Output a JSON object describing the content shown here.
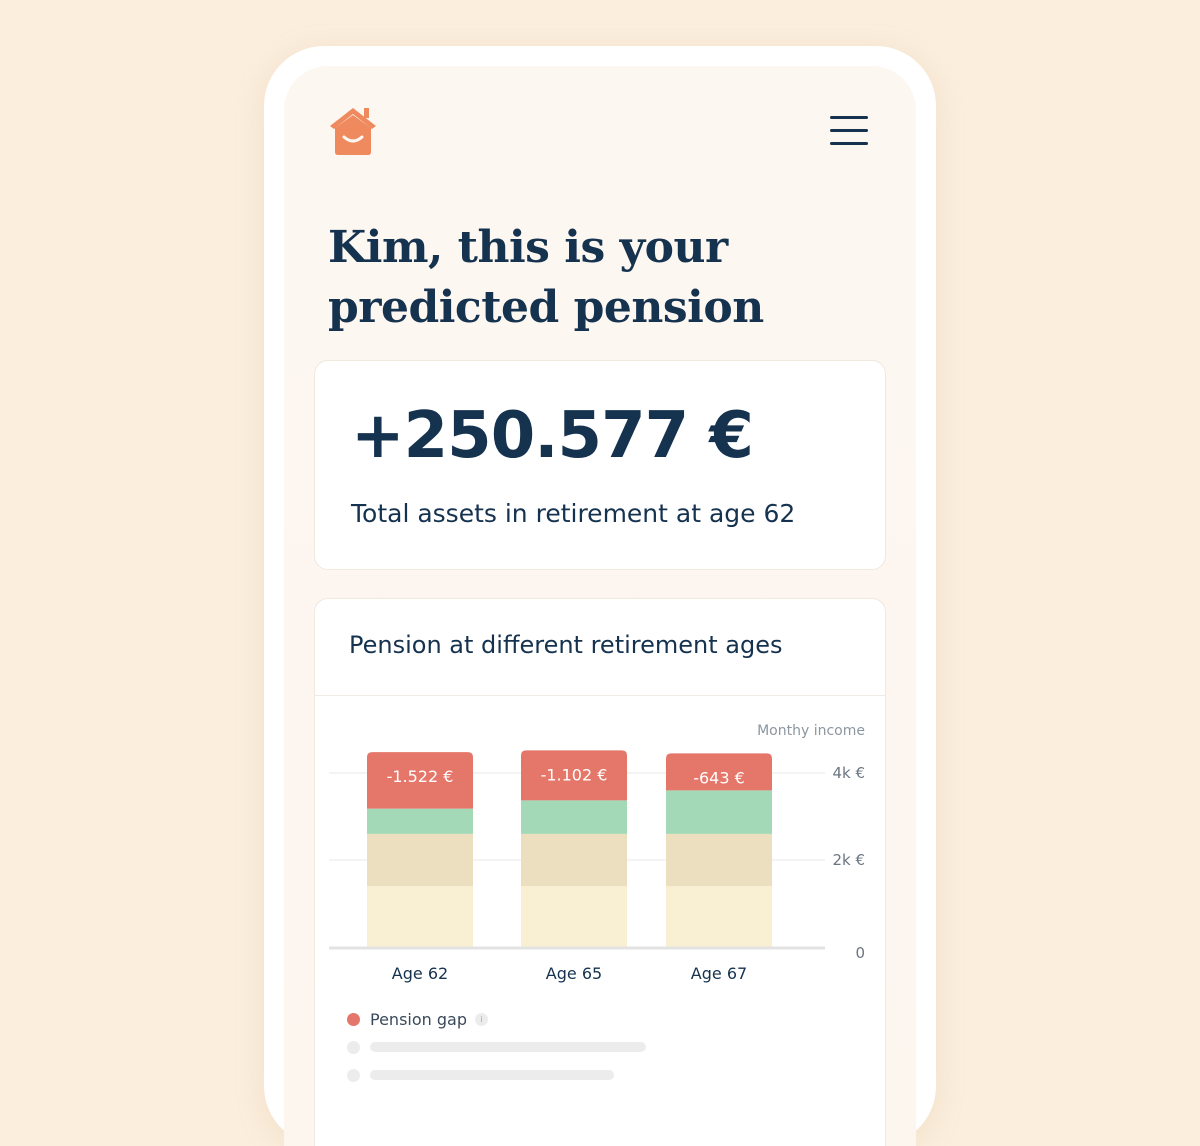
{
  "header": {
    "logo_icon": "smiling-house-icon",
    "menu_icon": "hamburger-menu-icon"
  },
  "headline": {
    "line1": "Kim, this is your",
    "line2": "predicted pension"
  },
  "assets": {
    "amount": "+250.577 €",
    "label": "Total assets in retirement at age 62"
  },
  "chart_card": {
    "title": "Pension at different retirement ages"
  },
  "chart_data": {
    "type": "bar",
    "stacked": true,
    "categories": [
      "Age 62",
      "Age 65",
      "Age 67"
    ],
    "ylabel": "Monthy income",
    "y_ticks": [
      "0",
      "2k €",
      "4k €"
    ],
    "ylim": [
      0,
      4000
    ],
    "grid": true,
    "series": [
      {
        "name": "",
        "color": "#f9efd2",
        "values": [
          1400,
          1400,
          1400
        ]
      },
      {
        "name": "",
        "color": "#ecdfc0",
        "values": [
          1200,
          1200,
          1200
        ]
      },
      {
        "name": "",
        "color": "#a3d9b7",
        "values": [
          580,
          770,
          1000
        ]
      },
      {
        "name": "Pension gap",
        "color": "#e4776a",
        "values": [
          1300,
          1150,
          850
        ],
        "labels": [
          "-1.522 €",
          "-1.102 €",
          "-643 €"
        ]
      }
    ]
  },
  "legend": {
    "gap_label": "Pension gap",
    "gap_color": "#e4776a",
    "info_glyph": "i"
  },
  "colors": {
    "primary_text": "#15324f",
    "brand_orange": "#ef8a5f",
    "background": "#fbeedd"
  }
}
